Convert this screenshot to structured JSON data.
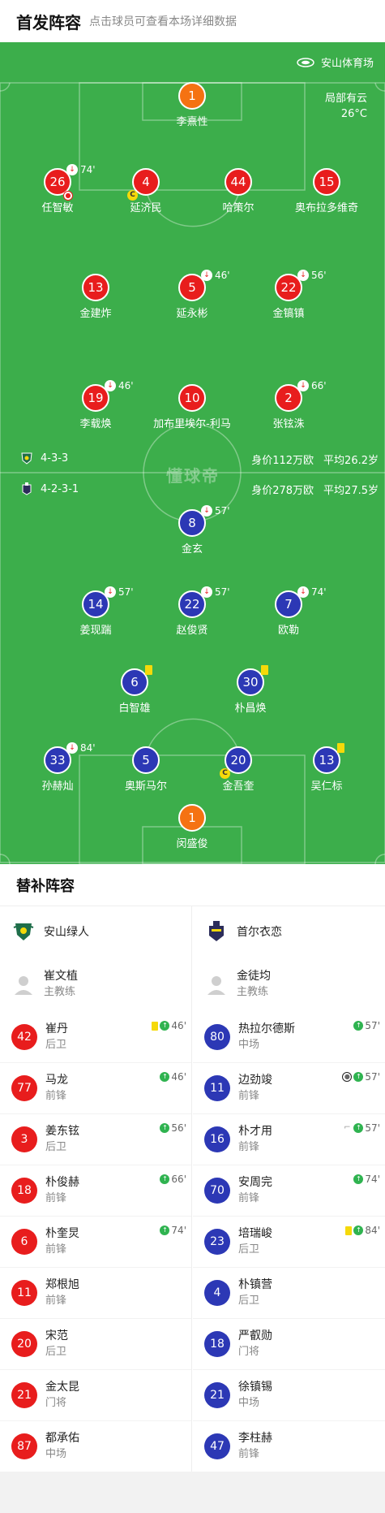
{
  "header": {
    "title": "首发阵容",
    "subtitle": "点击球员可查看本场详细数据"
  },
  "venue": "安山体育场",
  "weather": {
    "condition": "局部有云",
    "temperature": "26°C"
  },
  "watermark": "懂球帝",
  "home": {
    "formation": "4-3-3",
    "value": "身价112万欧",
    "avg_age": "平均26.2岁",
    "color": "#e81d1d"
  },
  "away": {
    "formation": "4-2-3-1",
    "value": "身价278万欧",
    "avg_age": "平均27.5岁",
    "color": "#2c38b5"
  },
  "home_lineup": {
    "gk": {
      "number": "1",
      "name": "李熹性"
    },
    "def1": {
      "number": "26",
      "name": "任智敏",
      "sub": "74'"
    },
    "def2": {
      "number": "4",
      "name": "延济民"
    },
    "def3": {
      "number": "44",
      "name": "哈策尔"
    },
    "def4": {
      "number": "15",
      "name": "奥布拉多维奇"
    },
    "mid1": {
      "number": "13",
      "name": "金建炸"
    },
    "mid2": {
      "number": "5",
      "name": "延永彬",
      "sub": "46'"
    },
    "mid3": {
      "number": "22",
      "name": "金镐镇",
      "sub": "56'"
    },
    "fw1": {
      "number": "19",
      "name": "李载焕",
      "sub": "46'"
    },
    "fw2": {
      "number": "10",
      "name": "加布里埃尔-利马"
    },
    "fw3": {
      "number": "2",
      "name": "张铉洙",
      "sub": "66'"
    }
  },
  "away_lineup": {
    "am": {
      "number": "8",
      "name": "金玄",
      "sub": "57'"
    },
    "w1": {
      "number": "14",
      "name": "姜现踹",
      "sub": "57'"
    },
    "w2": {
      "number": "22",
      "name": "赵俊贤",
      "sub": "57'"
    },
    "w3": {
      "number": "7",
      "name": "欧勒",
      "sub": "74'"
    },
    "dm1": {
      "number": "6",
      "name": "白智雄"
    },
    "dm2": {
      "number": "30",
      "name": "朴昌焕"
    },
    "def1": {
      "number": "33",
      "name": "孙赫灿",
      "sub": "84'"
    },
    "def2": {
      "number": "5",
      "name": "奥斯马尔"
    },
    "def3": {
      "number": "20",
      "name": "金吾奎"
    },
    "def4": {
      "number": "13",
      "name": "吴仁标"
    },
    "gk": {
      "number": "1",
      "name": "闵盛俊"
    }
  },
  "subs": {
    "title": "替补阵容",
    "home_team": "安山绿人",
    "away_team": "首尔衣恋",
    "home_coach": {
      "name": "崔文植",
      "role": "主教练"
    },
    "away_coach": {
      "name": "金徒均",
      "role": "主教练"
    },
    "home": [
      {
        "number": "42",
        "name": "崔丹",
        "pos": "后卫",
        "minute": "46'"
      },
      {
        "number": "77",
        "name": "马龙",
        "pos": "前锋",
        "minute": "46'"
      },
      {
        "number": "3",
        "name": "姜东铉",
        "pos": "后卫",
        "minute": "56'"
      },
      {
        "number": "18",
        "name": "朴俊赫",
        "pos": "前锋",
        "minute": "66'"
      },
      {
        "number": "6",
        "name": "朴奎炅",
        "pos": "前锋",
        "minute": "74'"
      },
      {
        "number": "11",
        "name": "郑根旭",
        "pos": "前锋"
      },
      {
        "number": "20",
        "name": "宋范",
        "pos": "后卫"
      },
      {
        "number": "21",
        "name": "金太昆",
        "pos": "门将"
      },
      {
        "number": "87",
        "name": "都承佑",
        "pos": "中场"
      }
    ],
    "away": [
      {
        "number": "80",
        "name": "热拉尔德斯",
        "pos": "中场",
        "minute": "57'"
      },
      {
        "number": "11",
        "name": "边劲竣",
        "pos": "前锋",
        "minute": "57'"
      },
      {
        "number": "16",
        "name": "朴才用",
        "pos": "前锋",
        "minute": "57'"
      },
      {
        "number": "70",
        "name": "安周完",
        "pos": "前锋",
        "minute": "74'"
      },
      {
        "number": "23",
        "name": "培瑞峻",
        "pos": "后卫",
        "minute": "84'"
      },
      {
        "number": "4",
        "name": "朴镇营",
        "pos": "后卫"
      },
      {
        "number": "18",
        "name": "严叡勋",
        "pos": "门将"
      },
      {
        "number": "21",
        "name": "徐镇锡",
        "pos": "中场"
      },
      {
        "number": "47",
        "name": "李柱赫",
        "pos": "前锋"
      }
    ]
  }
}
